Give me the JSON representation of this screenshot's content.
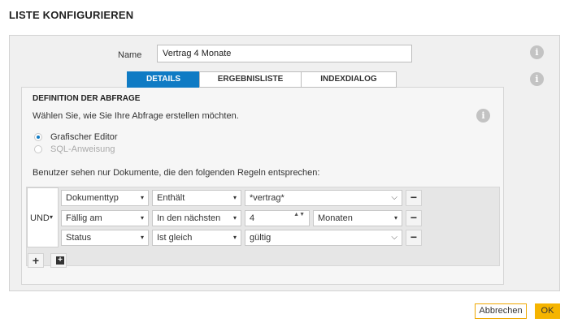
{
  "page": {
    "title": "LISTE KONFIGURIEREN"
  },
  "name_field": {
    "label": "Name",
    "value": "Vertrag 4 Monate"
  },
  "tabs": [
    {
      "label": "DETAILS",
      "active": true
    },
    {
      "label": "ERGEBNISLISTE",
      "active": false
    },
    {
      "label": "INDEXDIALOG",
      "active": false
    }
  ],
  "query": {
    "title": "DEFINITION DER ABFRAGE",
    "description": "Wählen Sie, wie Sie Ihre Abfrage erstellen möchten.",
    "options": [
      {
        "label": "Grafischer Editor",
        "selected": true,
        "enabled": true
      },
      {
        "label": "SQL-Anweisung",
        "selected": false,
        "enabled": false
      }
    ],
    "rules_description": "Benutzer sehen nur Dokumente, die den folgenden Regeln entsprechen:"
  },
  "rules": {
    "operator": "UND",
    "rows": [
      {
        "field": "Dokumenttyp",
        "condition": "Enthält",
        "value": "*vertrag*",
        "unit": ""
      },
      {
        "field": "Fällig am",
        "condition": "In den nächsten",
        "value": "4",
        "unit": "Monaten"
      },
      {
        "field": "Status",
        "condition": "Ist gleich",
        "value": "gültig",
        "unit": ""
      }
    ]
  },
  "footer": {
    "cancel_label": "Abbrechen",
    "ok_label": "OK"
  },
  "colors": {
    "accent": "#0f7bc4",
    "ok_button": "#f5b400",
    "info_icon": "#c3c3c3"
  },
  "icons": {
    "info": "i",
    "caret": "▾",
    "chevron": "⌵",
    "spin": "▲▼",
    "minus": "−",
    "plus": "+",
    "plus_box": "+"
  }
}
